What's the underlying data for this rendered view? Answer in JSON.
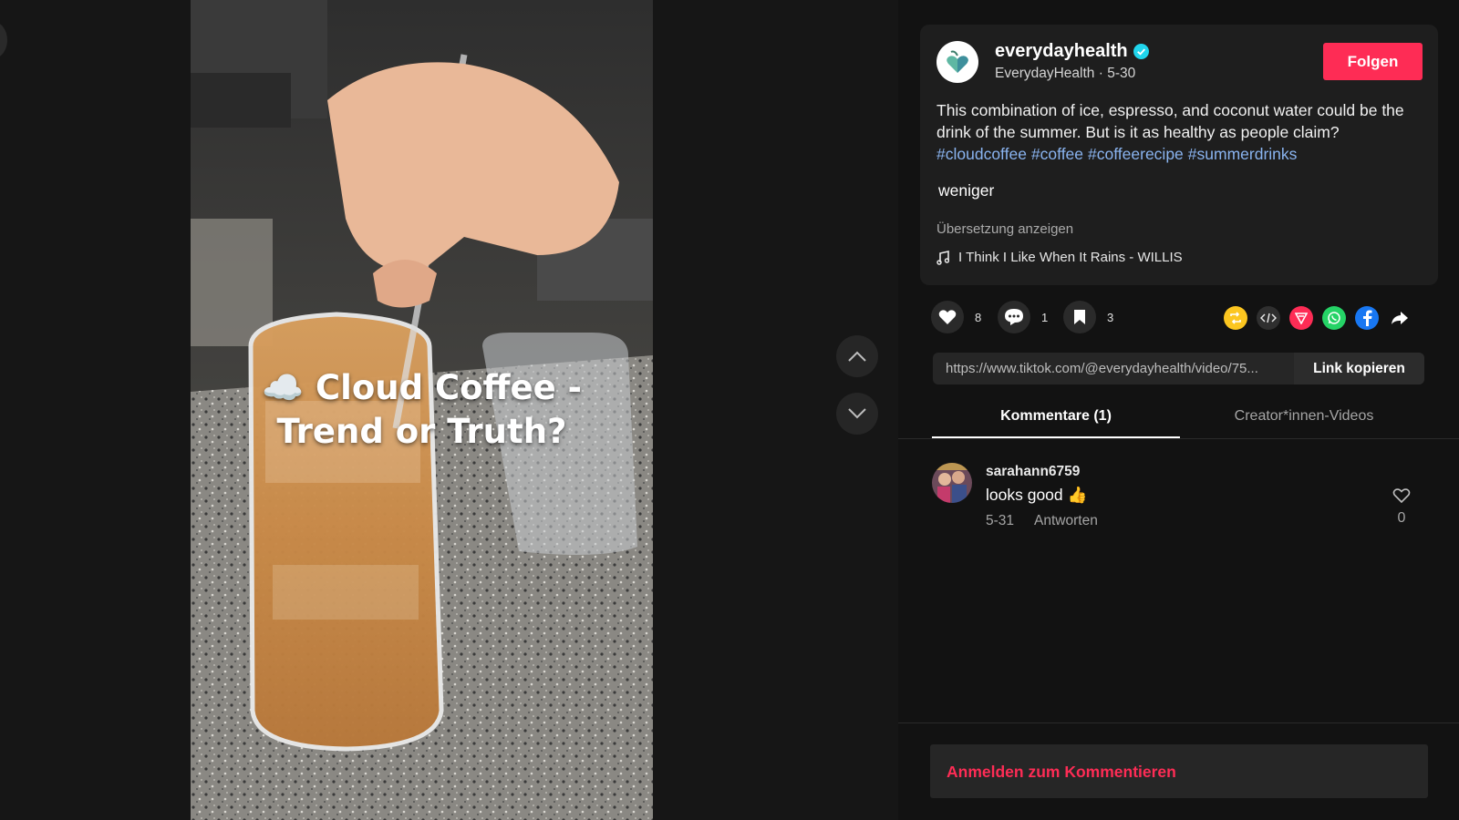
{
  "video": {
    "caption_line1": "☁️ Cloud Coffee -",
    "caption_line2": "Trend or Truth?"
  },
  "author": {
    "handle": "everydayhealth",
    "display_name": "EverydayHealth",
    "date": "5-30",
    "separator": " · ",
    "verified": true,
    "follow_label": "Folgen"
  },
  "description": {
    "text": "This combination of ice, espresso, and coconut water could be the drink of the summer. But is it as healthy as people claim?",
    "hashtags": [
      "#cloudcoffee",
      "#coffee",
      "#coffeerecipe",
      "#summerdrinks"
    ],
    "less_label": "weniger",
    "translate_label": "Übersetzung anzeigen",
    "music": "I Think I Like When It Rains - WILLIS"
  },
  "actions": {
    "likes": "8",
    "comments": "1",
    "saves": "3",
    "share_icons": [
      "repost-icon",
      "embed-icon",
      "send-icon",
      "whatsapp-icon",
      "facebook-icon",
      "share-arrow-icon"
    ]
  },
  "link": {
    "url": "https://www.tiktok.com/@everydayhealth/video/75...",
    "copy_label": "Link kopieren"
  },
  "tabs": {
    "comments": "Kommentare (1)",
    "creator": "Creator*innen-Videos"
  },
  "comments": [
    {
      "user": "sarahann6759",
      "text": "looks good 👍",
      "date": "5-31",
      "reply_label": "Antworten",
      "likes": "0"
    }
  ],
  "login": {
    "label": "Anmelden zum Kommentieren"
  },
  "colors": {
    "accent": "#fe2c55",
    "hashtag": "#8ab4f0",
    "background": "#121212",
    "card": "#1e1e1e"
  }
}
